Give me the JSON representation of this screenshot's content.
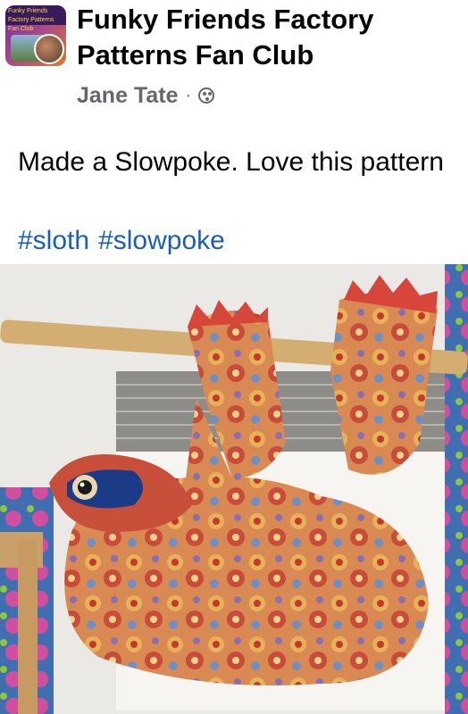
{
  "post": {
    "group_name": "Funky Friends Factory Patterns Fan Club",
    "author": "Jane Tate",
    "separator": "·",
    "audience_icon": "public-globe-icon",
    "text": "Made a Slowpoke.  Love this pattern",
    "hashtags": [
      "#sloth",
      "#slowpoke"
    ],
    "avatar_text": "Funky Friends Factory Patterns Fan Club"
  },
  "colors": {
    "title": "#050505",
    "meta": "#65676b",
    "hashtag": "#1b5fb4",
    "fabric_base": "#d98a52",
    "fabric_dark": "#b5542c"
  }
}
